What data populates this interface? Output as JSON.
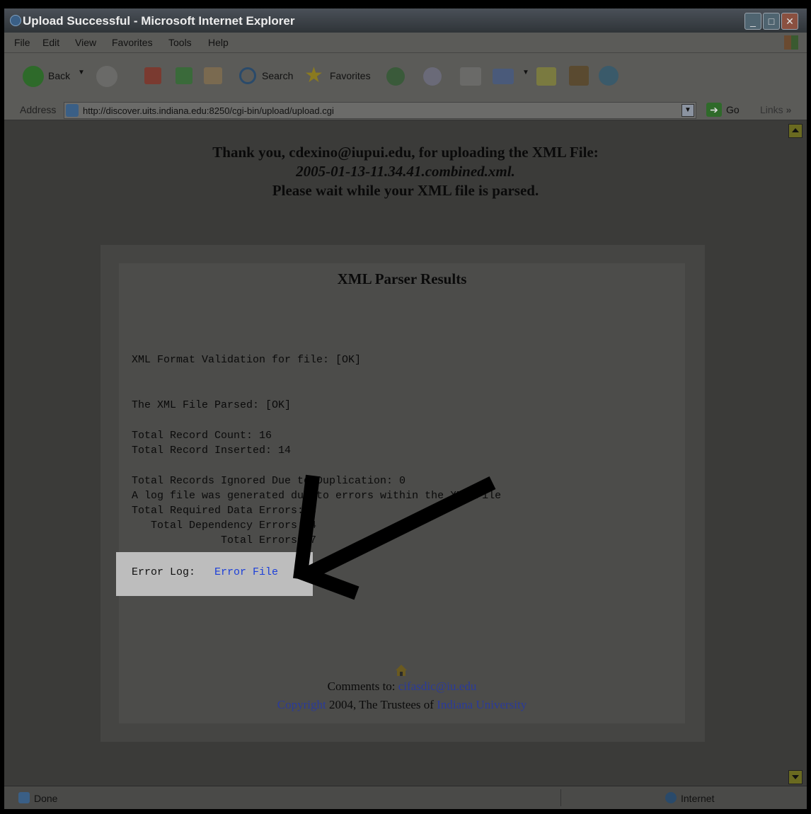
{
  "window": {
    "title": "Upload Successful - Microsoft Internet Explorer",
    "controls": [
      "minimize",
      "maximize",
      "close"
    ]
  },
  "menu": {
    "items": [
      "File",
      "Edit",
      "View",
      "Favorites",
      "Tools",
      "Help"
    ]
  },
  "toolbar": {
    "back_label": "Back",
    "search_label": "Search",
    "favorites_label": "Favorites"
  },
  "address": {
    "label": "Address",
    "url": "http://discover.uits.indiana.edu:8250/cgi-bin/upload/upload.cgi",
    "go_label": "Go",
    "links_label": "Links"
  },
  "page": {
    "thanks_line": "Thank you, cdexino@iupui.edu, for uploading the XML File:",
    "file_name": "2005-01-13-11.34.41.combined.xml.",
    "wait_line": "Please wait while your XML file is parsed.",
    "results_title": "XML Parser Results",
    "lines": {
      "format_validation": "XML Format Validation for file: [OK]",
      "parsed": "The XML File Parsed: [OK]",
      "record_count": "Total Record Count: 16",
      "record_inserted": "Total Record Inserted: 14",
      "ignored": "Total Records Ignored Due to Duplication: 0",
      "log_generated": "A log file was generated due to errors within the XML File",
      "required_errors": "Total Required Data Errors: 3",
      "dependency_errors": "   Total Dependency Errors: 4",
      "total_errors": "              Total Errors: 7"
    },
    "error_log_label": "Error Log:",
    "error_log_link": "Error File",
    "footer": {
      "comments_prefix": "Comments to: ",
      "comments_email": "cifasdic@iu.edu",
      "copyright_link": "Copyright",
      "copyright_mid": " 2004, The Trustees of ",
      "university_link": "Indiana University"
    }
  },
  "status": {
    "text": "Done",
    "zone": "Internet"
  },
  "icons": [
    "ie-icon",
    "back-icon",
    "forward-icon",
    "stop-icon",
    "refresh-icon",
    "home-icon",
    "search-icon",
    "favorites-star-icon",
    "history-icon",
    "mail-icon",
    "print-icon",
    "edit-icon",
    "discuss-icon",
    "research-icon",
    "messenger-icon",
    "page-icon",
    "go-arrow-icon",
    "globe-icon",
    "windows-logo-icon",
    "annotation-arrow"
  ]
}
